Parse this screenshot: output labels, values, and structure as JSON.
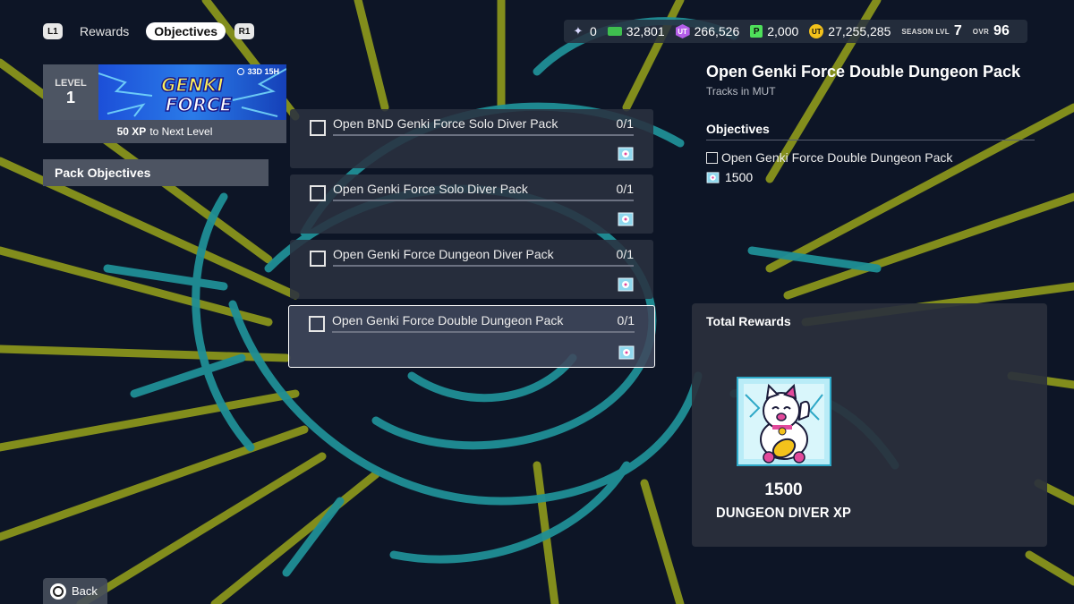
{
  "topnav": {
    "left_shoulder": "L1",
    "right_shoulder": "R1",
    "tabs": [
      {
        "label": "Rewards",
        "active": false
      },
      {
        "label": "Objectives",
        "active": true
      }
    ]
  },
  "currencies": {
    "fox_tokens": "0",
    "coins": "32,801",
    "ut_purple": "266,526",
    "ut_purple_icon": "UT",
    "p_points": "2,000",
    "p_icon": "P",
    "ut_gold": "27,255,285",
    "ut_gold_icon": "UT",
    "season_label": "SEASON LVL",
    "season_value": "7",
    "ovr_label": "OVR",
    "ovr_value": "96"
  },
  "level": {
    "label": "LEVEL",
    "value": "1",
    "timer": "33D 15H",
    "banner_logo": "GENKI FORCE",
    "xp_amount": "50 XP",
    "xp_suffix": "to Next Level"
  },
  "sidebar": {
    "items": [
      {
        "label": "Pack Objectives",
        "selected": true
      }
    ]
  },
  "objectives": [
    {
      "title": "Open BND Genki Force Solo Diver Pack",
      "progress": "0/1",
      "selected": false
    },
    {
      "title": "Open Genki Force Solo Diver Pack",
      "progress": "0/1",
      "selected": false
    },
    {
      "title": "Open Genki Force Dungeon Diver Pack",
      "progress": "0/1",
      "selected": false
    },
    {
      "title": "Open Genki Force Double Dungeon Pack",
      "progress": "0/1",
      "selected": true
    }
  ],
  "detail": {
    "title": "Open Genki Force Double Dungeon Pack",
    "subtitle": "Tracks in MUT",
    "objectives_heading": "Objectives",
    "objective_text": "Open Genki Force Double Dungeon Pack",
    "reward_value": "1500"
  },
  "rewards": {
    "heading": "Total Rewards",
    "amount": "1500",
    "name": "DUNGEON DIVER XP"
  },
  "back": {
    "label": "Back"
  },
  "colors": {
    "background": "#0d1526",
    "teal_burst": "#1f8f96",
    "yellow_lines": "#8f9a1c",
    "panel": "#2a3140",
    "accent_white": "#ffffff"
  }
}
